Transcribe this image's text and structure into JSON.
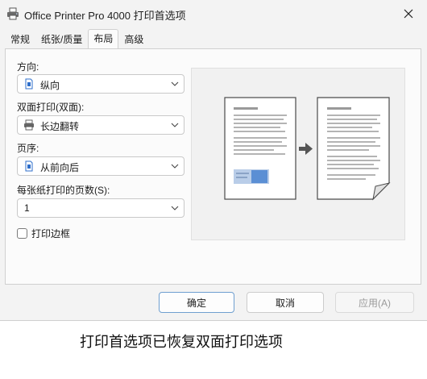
{
  "window": {
    "title": "Office Printer Pro 4000 打印首选项",
    "icons": {
      "app": "printer-icon",
      "close": "close-icon"
    }
  },
  "tabs": [
    {
      "label": "常规",
      "active": false
    },
    {
      "label": "纸张/质量",
      "active": false
    },
    {
      "label": "布局",
      "active": true
    },
    {
      "label": "高级",
      "active": false
    }
  ],
  "layout": {
    "orientation": {
      "label": "方向:",
      "value": "纵向",
      "icon": "portrait-page-icon"
    },
    "duplex": {
      "label": "双面打印(双面):",
      "value": "长边翻转",
      "icon": "printer-icon"
    },
    "page_order": {
      "label": "页序:",
      "value": "从前向后",
      "icon": "page-icon"
    },
    "pages_per_sheet": {
      "label": "每张纸打印的页数(S):",
      "value": "1"
    },
    "print_borders": {
      "label": "打印边框",
      "checked": false
    }
  },
  "preview": {
    "icons": [
      "page-preview-icon",
      "arrow-right-icon",
      "page-turn-icon"
    ]
  },
  "buttons": {
    "ok": "确定",
    "cancel": "取消",
    "apply": "应用(A)"
  },
  "caption": "打印首选项已恢复双面打印选项",
  "colors": {
    "accent": "#5b8fd4",
    "dialog_bg": "#f3f3f3",
    "panel_bg": "#fbfbfb"
  }
}
